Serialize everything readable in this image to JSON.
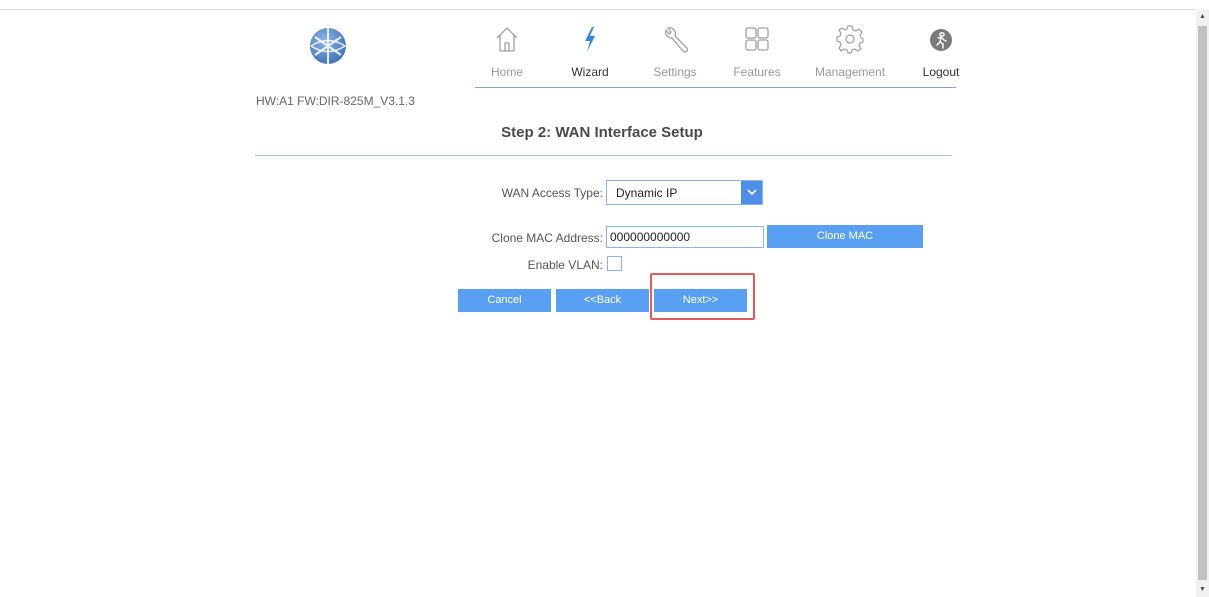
{
  "device": {
    "hw_fw": "HW:A1 FW:DIR-825M_V3.1.3"
  },
  "nav": {
    "items": [
      {
        "label": "Home",
        "icon": "home-icon"
      },
      {
        "label": "Wizard",
        "icon": "lightning-icon"
      },
      {
        "label": "Settings",
        "icon": "wrench-icon"
      },
      {
        "label": "Features",
        "icon": "grid-icon"
      },
      {
        "label": "Management",
        "icon": "gear-icon"
      },
      {
        "label": "Logout",
        "icon": "logout-icon"
      }
    ],
    "active": "Wizard"
  },
  "page": {
    "title": "Step 2: WAN Interface Setup"
  },
  "form": {
    "wan_access_type": {
      "label": "WAN Access Type:",
      "value": "Dynamic IP"
    },
    "clone_mac": {
      "label": "Clone MAC Address:",
      "value": "000000000000",
      "button": "Clone MAC"
    },
    "enable_vlan": {
      "label": "Enable VLAN:",
      "checked": false
    }
  },
  "buttons": {
    "cancel": "Cancel",
    "back": "<<Back",
    "next": "Next>>"
  },
  "colors": {
    "accent": "#5aa0f2",
    "highlight": "#e05b5b",
    "border": "#8eb4e3"
  }
}
